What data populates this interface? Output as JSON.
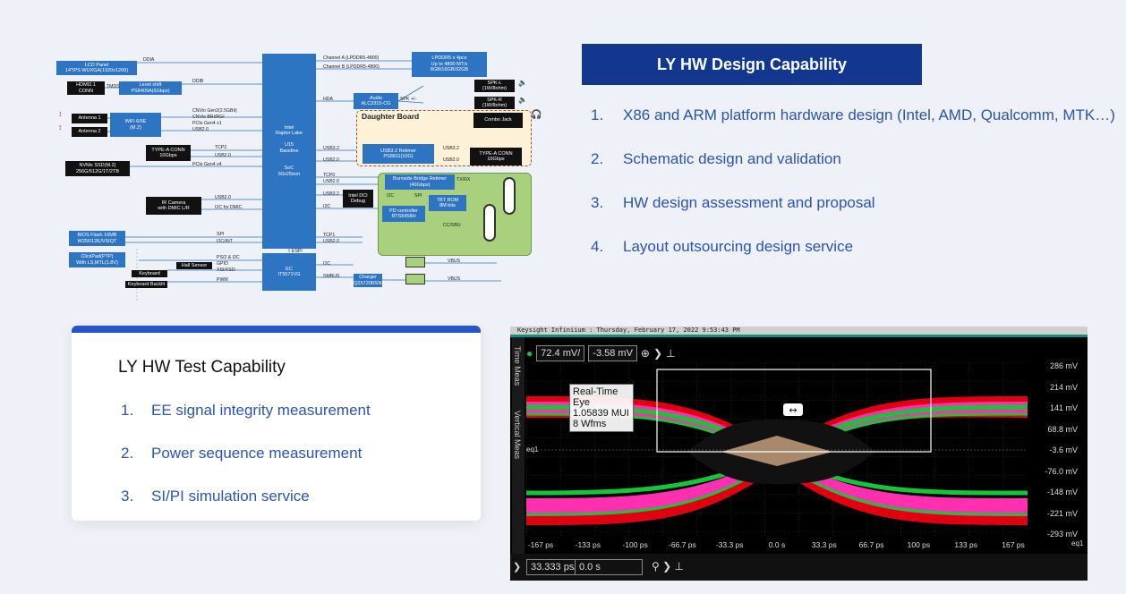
{
  "diagram": {
    "soc_block": "Intel\nRaptor Lake\n\nU15\nBaseline\n\n\nSoC\n50x25mm",
    "ec_block": "EC\nIT5571VG",
    "lcd_panel": "LCD Panel\n14\"IPS WUXGA(1920x1200)",
    "hdmi_conn": "HDMI2.1\nCONN",
    "level_shift": "Level shift\nPS8409A(6Gbps)",
    "antenna1": "Antenna 1",
    "antenna2": "Antenna 2",
    "wifi": "WiFi 6/6E\n(M.2)",
    "typea_left": "TYPE-A CONN\n10Gbps",
    "nvme": "NVMe SSD(M.2)\n256G/512G/1T/2TB",
    "ir_camera": "IR Camera\nwith DMIC L/R",
    "bios": "BIOS Flash 16MB\nW25R128JVSIQT",
    "clickpad": "ClickPad(PTP)\nWith LS,MTL(1.8V)",
    "hall_sensor": "Hall Sensor",
    "keyboard": "Keyboard",
    "keyboard_backlit": "Keyboard Backlit",
    "lpddr5": "LPDDR5 x 4pcs\nUp to 4800 MT/s\n8GB/16GB/32GB",
    "audio": "Audio\nALC3315-CG",
    "spk_l": "SPK-L\n(1W/8ohm)",
    "spk_r": "SPK-R\n(1W/8ohm)",
    "daughter_board": "Daughter Board",
    "sleeve_ring": "SLEEVE/RING",
    "combo_jack": "Combo Jack",
    "usb_retimer": "USB3.2 Retimer\nPS8811(10G)",
    "typea_right": "TYPE-A CONN\n10Gbps",
    "burnside": "Burnside Bridge Retimer\n(40Gbps)",
    "intel_dci": "Intel DCI\nDebug",
    "tbt_rom": "TBT ROM\n8M bits",
    "pd_controller": "PD controller\nRTS5458H",
    "charger": "Charger\nBQ25720RSNR",
    "labels": {
      "ddia": "DDIA",
      "ddib": "DDIB",
      "tmds": "TMDS",
      "chA": "Channel A (LPDDR5-4800)",
      "chB": "Channel B (LPDDR5-4800)",
      "hda": "HDA",
      "spk": "SPK +/-",
      "cnvio1": "CNVio Gen2(2.5GBit)",
      "cnvio2": "CNVio BRI/RGI",
      "pcie_x1": "PCIe Gen4 x1",
      "usb20_a": "USB2.0",
      "tcp2": "TCP2",
      "usb20_b": "USB2.0",
      "pcie_x4": "PCIe Gen4 x4",
      "usb32_a": "USB3.2",
      "usb20_c": "USB2.0",
      "usb32_b": "USB3.2",
      "usb20_d": "USB2.0",
      "tcp0": "TCP0",
      "usb20_e": "USB2.0",
      "usb32_c": "USB3.2",
      "i2c_a": "I2C",
      "usb20_f": "USB2.0",
      "i2c_dmic": "I2C for DMIC",
      "spi_a": "SPI",
      "i2c_int": "I2C/INT",
      "tcp1": "TCP1",
      "usb20_g": "USB2.0",
      "espi": "ESPI",
      "ps2": "PS/2 & I2C",
      "gpio": "GPIO",
      "xsi": "XSI/XSO",
      "pwm": "PWM",
      "i2c_b": "I2C",
      "smbus": "SMBUS",
      "txrx": "TX/RX",
      "i2c_c": "I2C",
      "spi_b": "SPI",
      "ccsbu": "CC/SBU",
      "vbus_a": "VBUS",
      "vbus_b": "VBUS"
    }
  },
  "design": {
    "title": "LY HW Design Capability",
    "items": [
      {
        "num": "1.",
        "text": "X86 and ARM platform hardware design (Intel, AMD, Qualcomm, MTK…)"
      },
      {
        "num": "2.",
        "text": "Schematic design and validation"
      },
      {
        "num": "3.",
        "text": "HW design assessment and proposal"
      },
      {
        "num": "4.",
        "text": "Layout outsourcing design service"
      }
    ]
  },
  "test": {
    "title": "LY HW Test Capability",
    "items": [
      {
        "num": "1.",
        "text": "EE signal integrity measurement"
      },
      {
        "num": "2.",
        "text": "Power sequence measurement"
      },
      {
        "num": "3.",
        "text": "SI/PI simulation service"
      }
    ]
  },
  "scope": {
    "header": "Keysight Infiniium : Thursday, February 17, 2022 9:53:43 PM",
    "side_tab1": "Time Meas",
    "side_tab2": "Vertical Meas",
    "volts_per_div": "72.4 mV/",
    "offset": "-3.58 mV",
    "eye_info": [
      "Real-Time Eye",
      "1.05839 MUI",
      "8 Wfms"
    ],
    "y_ticks": [
      "286 mV",
      "214 mV",
      "141 mV",
      "68.8 mV",
      "-3.6 mV",
      "-76.0 mV",
      "-148 mV",
      "-221 mV",
      "-293 mV"
    ],
    "x_ticks": [
      "-167 ps",
      "-133 ps",
      "-100 ps",
      "-66.7 ps",
      "-33.3 ps",
      "0.0 s",
      "33.3 ps",
      "66.7 ps",
      "100 ps",
      "133 ps",
      "167 ps"
    ],
    "channel_label": "eq1",
    "marker_label": "eq1",
    "time_per_div": "33.333 ps/",
    "time_offset": "0.0 s",
    "colors": {
      "outer": "#e00010",
      "mid": "#ff2fb0",
      "inner": "#16c63a",
      "opening": "#111111",
      "mask": "#a8896c"
    }
  }
}
